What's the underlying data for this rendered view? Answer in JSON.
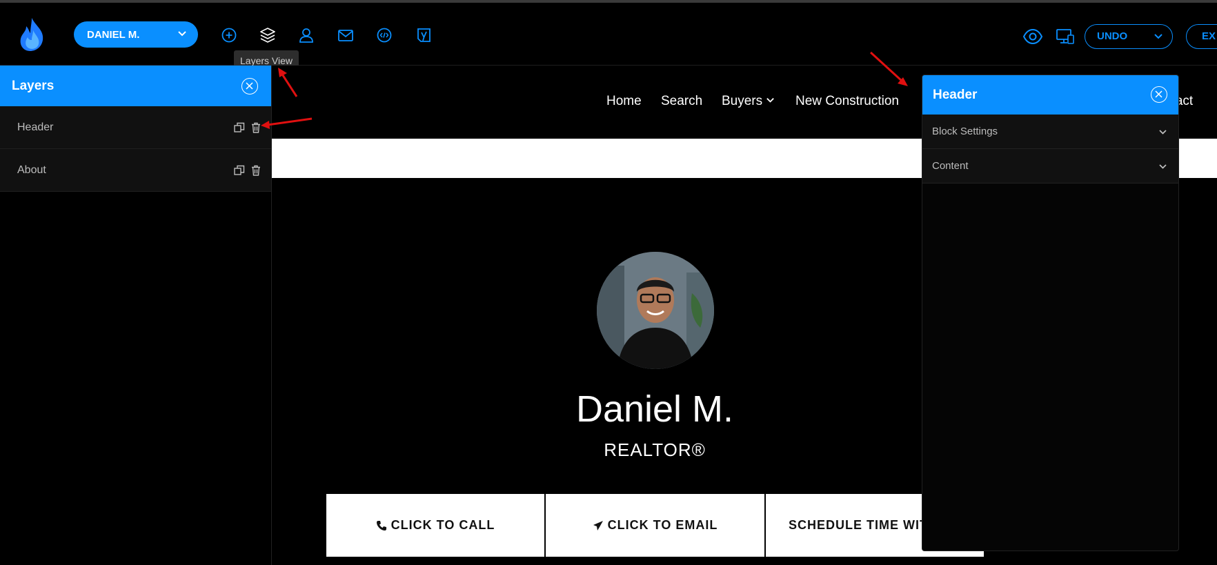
{
  "topbar": {
    "user_label": "DANIEL M.",
    "tooltip": "Layers View",
    "undo_label": "UNDO",
    "exit_label": "EX"
  },
  "layers_panel": {
    "title": "Layers",
    "items": [
      {
        "label": "Header"
      },
      {
        "label": "About"
      }
    ]
  },
  "site": {
    "nav": [
      "Home",
      "Search",
      "Buyers",
      "New Construction",
      "ntact"
    ],
    "hero_name": "Daniel M.",
    "hero_subtitle": "REALTOR®",
    "cta": {
      "call": "CLICK TO CALL",
      "email": "CLICK TO EMAIL",
      "schedule": "SCHEDULE TIME WITH ME"
    }
  },
  "header_panel": {
    "title": "Header",
    "sections": [
      "Block Settings",
      "Content"
    ]
  },
  "colors": {
    "accent": "#0a8fff",
    "annotation_arrow": "#e01010"
  }
}
